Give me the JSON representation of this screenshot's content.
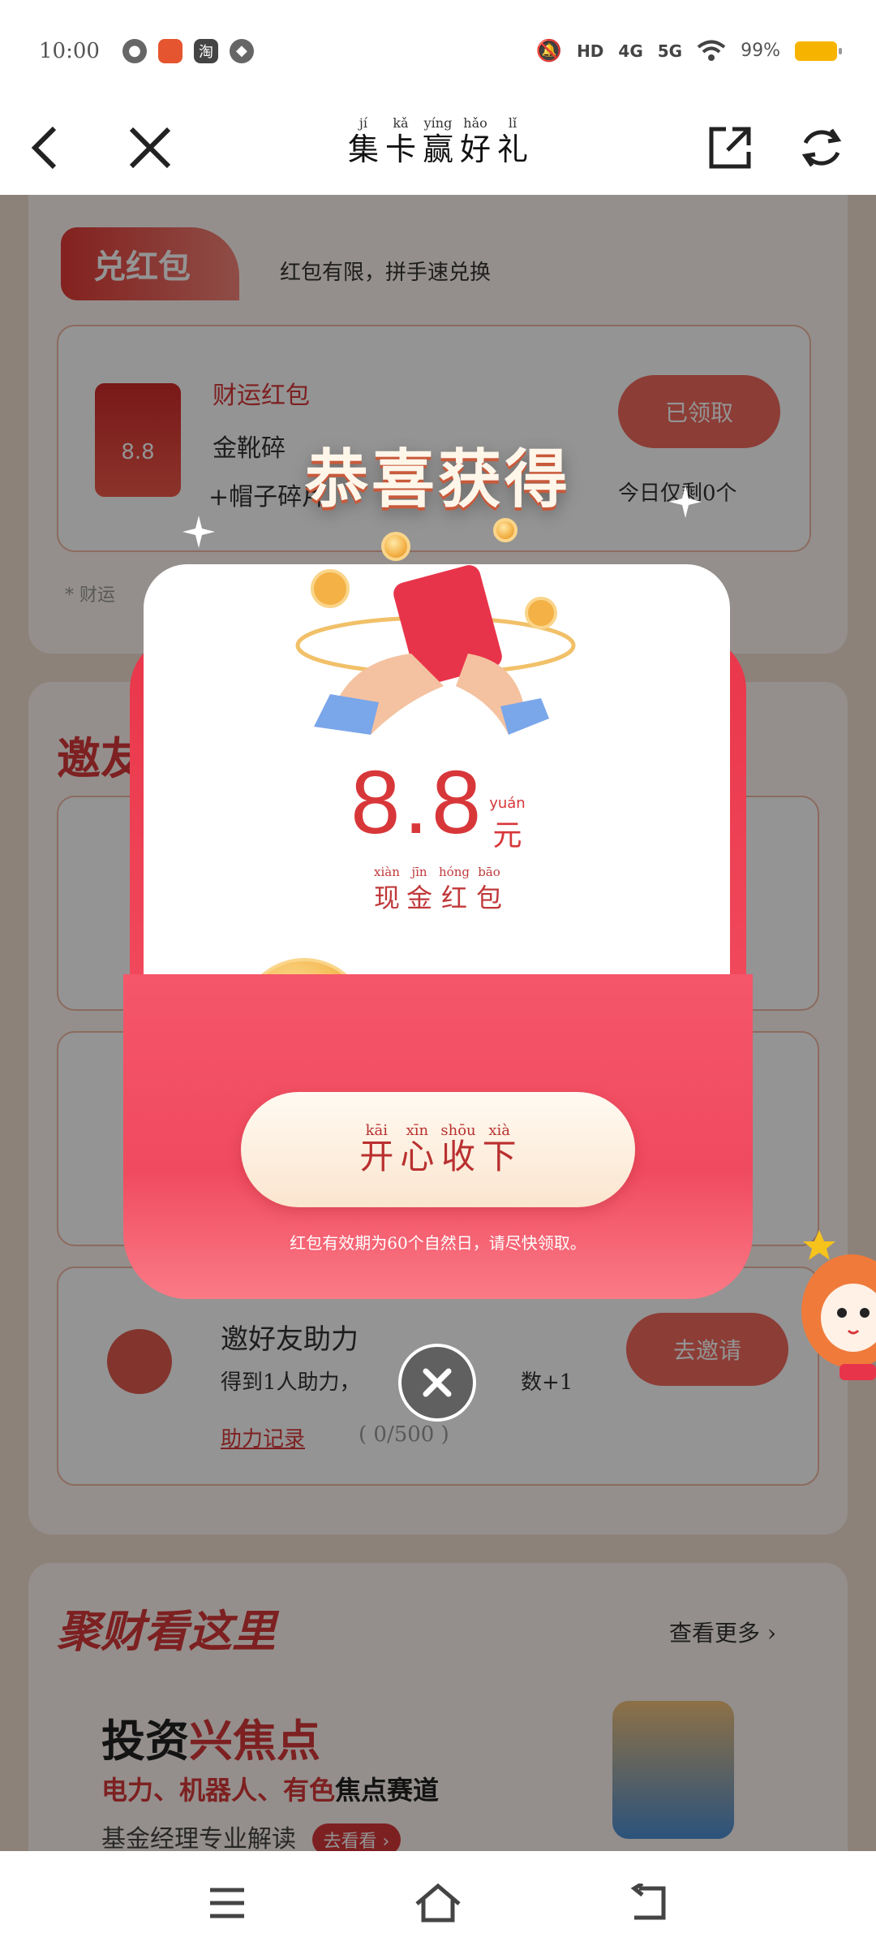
{
  "status_bar": {
    "time": "10:00",
    "app_icons": [
      "wechat-icon",
      "app-icon",
      "taobao-icon",
      "qq-icon"
    ],
    "taobao_char": "淘",
    "network": "HD",
    "sig1": "4G",
    "sig2": "5G",
    "battery": "99%"
  },
  "nav": {
    "title_words": [
      {
        "py": "jí",
        "hz": "集"
      },
      {
        "py": "kǎ",
        "hz": "卡"
      },
      {
        "py": "yíng",
        "hz": "赢"
      },
      {
        "py": "hǎo",
        "hz": "好"
      },
      {
        "py": "lǐ",
        "hz": "礼"
      }
    ]
  },
  "background": {
    "section1_tag": "兑红包",
    "section1_slogan": "红包有限，拼手速兑换",
    "item1_title": "财运红包",
    "item1_amount": "8.8",
    "item1_line1": "金靴碎",
    "item1_line2": "+帽子碎片",
    "item1_button": "已领取",
    "item1_remaining": "今日仅剩0个",
    "section1_note": "* 财运",
    "section2_tag": "邀友",
    "invite_title": "邀好友助力",
    "invite_desc": "得到1人助力，",
    "invite_desc_tail": "数+1",
    "invite_record": "助力记录",
    "invite_count": "( 0/500 )",
    "invite_button": "去邀请",
    "section3_title": "聚财看这里",
    "section3_more": "查看更多",
    "promo_title_a": "投资",
    "promo_title_b": "兴焦点",
    "promo_sub_a": "电力、机器人、有色",
    "promo_sub_b": "焦点赛道",
    "promo_desc": "基金经理专业解读",
    "promo_button": "去看看"
  },
  "popup": {
    "congrats": "恭喜获得",
    "amount": "8.8",
    "unit_py": "yuán",
    "unit": "元",
    "subtitle_words": [
      {
        "py": "xiàn",
        "hz": "现"
      },
      {
        "py": "jīn",
        "hz": "金"
      },
      {
        "py": "hóng",
        "hz": "红"
      },
      {
        "py": "bāo",
        "hz": "包"
      }
    ],
    "accept_words": [
      {
        "py": "kāi",
        "hz": "开"
      },
      {
        "py": "xīn",
        "hz": "心"
      },
      {
        "py": "shōu",
        "hz": "收"
      },
      {
        "py": "xià",
        "hz": "下"
      }
    ],
    "validity": "红包有效期为60个自然日，请尽快领取。"
  },
  "colors": {
    "accent_red": "#d8373a",
    "popup_red": "#ef4155",
    "gold": "#f3b146"
  }
}
